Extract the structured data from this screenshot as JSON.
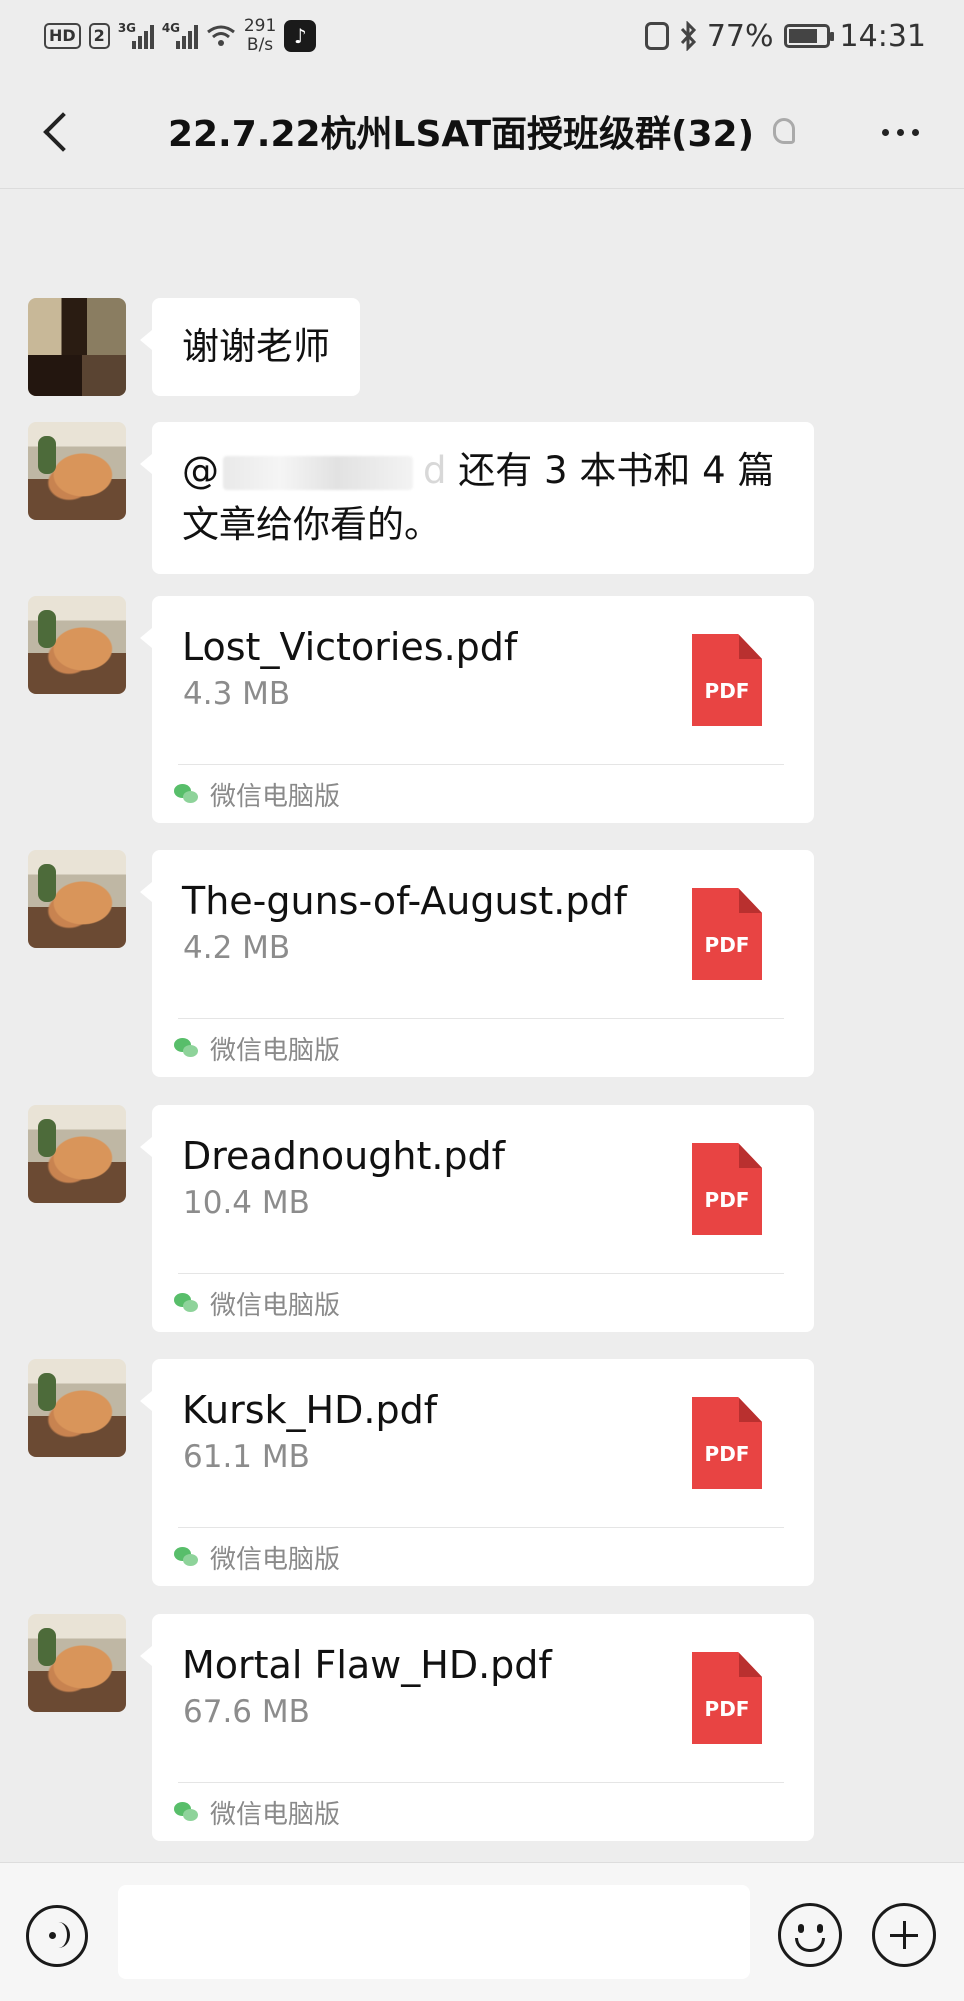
{
  "status_bar": {
    "hd_label": "HD",
    "sim_label": "2",
    "net1": "3G",
    "net2": "4G",
    "speed_value": "291",
    "speed_unit": "B/s",
    "battery": "77%",
    "time": "14:31"
  },
  "header": {
    "title": "22.7.22杭州LSAT面授班级群(32)"
  },
  "messages": [
    {
      "type": "text",
      "text": "谢谢老师"
    },
    {
      "type": "text",
      "mention_prefix": "@",
      "mention_tail": "d",
      "text": "还有 3 本书和 4 篇文章给你看的。"
    },
    {
      "type": "file",
      "name": "Lost_Victories.pdf",
      "size": "4.3 MB",
      "icon_label": "PDF",
      "source": "微信电脑版"
    },
    {
      "type": "file",
      "name": "The-guns-of-August.pdf",
      "size": "4.2 MB",
      "icon_label": "PDF",
      "source": "微信电脑版"
    },
    {
      "type": "file",
      "name": "Dreadnought.pdf",
      "size": "10.4 MB",
      "icon_label": "PDF",
      "source": "微信电脑版"
    },
    {
      "type": "file",
      "name": "Kursk_HD.pdf",
      "size": "61.1 MB",
      "icon_label": "PDF",
      "source": "微信电脑版"
    },
    {
      "type": "file",
      "name": "Mortal Flaw_HD.pdf",
      "size": "67.6 MB",
      "icon_label": "PDF",
      "source": "微信电脑版"
    }
  ],
  "input_bar": {
    "input_value": "",
    "voice_icon": "voice-icon",
    "emoji_icon": "emoji-icon",
    "plus_icon": "plus-icon"
  },
  "colors": {
    "background": "#ededed",
    "bubble": "#ffffff",
    "pdf_red": "#e84443",
    "wechat_green": "#58be6a"
  }
}
